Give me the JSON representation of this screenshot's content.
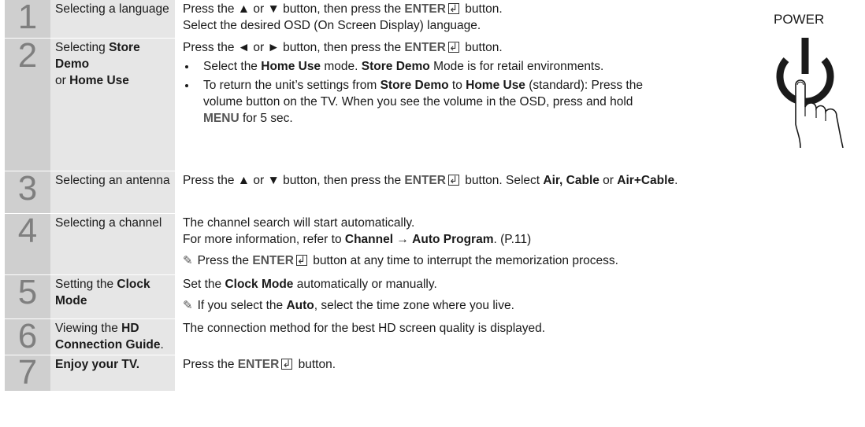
{
  "power_label": "POWER",
  "steps": [
    {
      "num": "1",
      "name": "Selecting a language",
      "desc1a": "Press the ▲ or ▼ button, then press the ",
      "enter": "ENTER",
      "desc1b": " button.",
      "desc2": "Select the desired OSD (On Screen Display) language."
    },
    {
      "num": "2",
      "name_a": "Selecting ",
      "name_b": "Store Demo",
      "name_c": "or ",
      "name_d": "Home Use",
      "desc1a": "Press the ◄ or ► button, then press the ",
      "enter": "ENTER",
      "desc1b": " button.",
      "bullet1_a": "Select the ",
      "bullet1_b": "Home Use",
      "bullet1_c": " mode. ",
      "bullet1_d": "Store Demo",
      "bullet1_e": " Mode is for retail environments.",
      "bullet2_a": "To return the unit’s settings from ",
      "bullet2_b": "Store Demo",
      "bullet2_c": " to ",
      "bullet2_d": "Home Use",
      "bullet2_e": " (standard): Press the volume button on the TV. When you see the volume in the OSD, press and hold ",
      "bullet2_f": "MENU",
      "bullet2_g": " for 5 sec."
    },
    {
      "num": "3",
      "name": "Selecting an antenna",
      "desc1a": "Press the ▲ or ▼ button, then press the ",
      "enter": "ENTER",
      "desc1b": " button. Select ",
      "opt1": "Air, Cable",
      "or": " or ",
      "opt2": "Air+Cable",
      "end": "."
    },
    {
      "num": "4",
      "name": "Selecting a channel",
      "desc1": "The channel search will start automatically.",
      "desc2a": "For more information, refer to ",
      "desc2b": "Channel",
      "desc2c": " → ",
      "desc2d": "Auto Program",
      "desc2e": ". (P.11)",
      "note_a": "Press the ",
      "enter": "ENTER",
      "note_b": " button at any time to interrupt the memorization process."
    },
    {
      "num": "5",
      "name_a": "Setting the ",
      "name_b": "Clock Mode",
      "desc1a": "Set the ",
      "desc1b": "Clock Mode",
      "desc1c": " automatically or manually.",
      "note_a": "If you select the ",
      "note_b": "Auto",
      "note_c": ", select the time zone where you live."
    },
    {
      "num": "6",
      "name_a": "Viewing the ",
      "name_b": "HD Connection Guide",
      "name_c": ".",
      "desc1": "The connection method for the best HD screen quality is displayed."
    },
    {
      "num": "7",
      "name": "Enjoy your TV.",
      "desc1a": "Press the ",
      "enter": "ENTER",
      "desc1b": " button."
    }
  ]
}
